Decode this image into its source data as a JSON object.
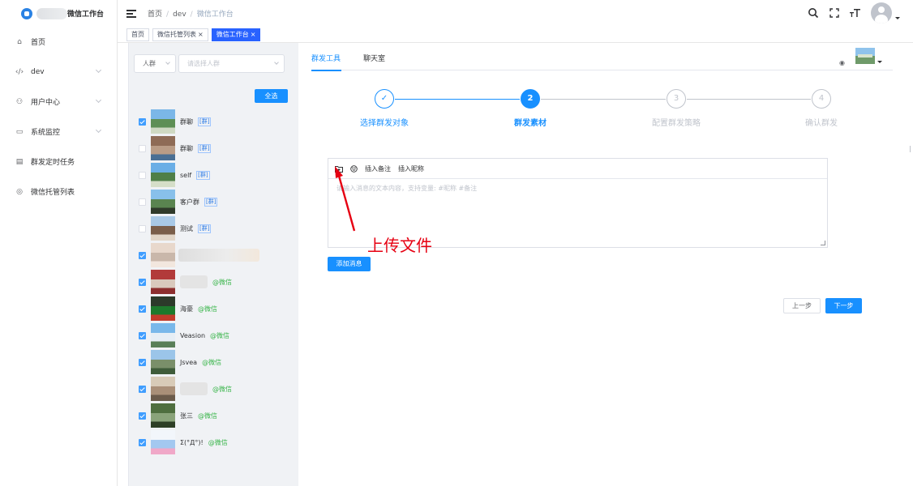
{
  "sidebar": {
    "brand": "微信工作台",
    "items": [
      {
        "label": "首页",
        "icon": "home-icon",
        "glyph": "⌂",
        "has_children": false
      },
      {
        "label": "dev",
        "icon": "code-icon",
        "glyph": "‹/›",
        "has_children": true
      },
      {
        "label": "用户中心",
        "icon": "user-center-icon",
        "glyph": "⚇",
        "has_children": true
      },
      {
        "label": "系统监控",
        "icon": "monitor-icon",
        "glyph": "▭",
        "has_children": true
      },
      {
        "label": "群发定时任务",
        "icon": "task-icon",
        "glyph": "▤",
        "has_children": false
      },
      {
        "label": "微信托管列表",
        "icon": "wechat-list-icon",
        "glyph": "◎",
        "has_children": false
      }
    ]
  },
  "header": {
    "breadcrumb": [
      "首页",
      "dev",
      "微信工作台"
    ]
  },
  "tags": [
    {
      "label": "首页",
      "active": false,
      "closable": false
    },
    {
      "label": "微信托管列表",
      "active": false,
      "closable": true
    },
    {
      "label": "微信工作台",
      "active": true,
      "closable": true
    }
  ],
  "filter": {
    "type_value": "人群",
    "select_placeholder": "请选择人群"
  },
  "select_all_label": "全选",
  "groups": [
    {
      "name": "群聊",
      "tag": "[群]",
      "tag_type": "group",
      "checked": true
    },
    {
      "name": "群聊",
      "tag": "[群]",
      "tag_type": "group",
      "checked": false
    },
    {
      "name": "self",
      "tag": "[群]",
      "tag_type": "group",
      "checked": false
    },
    {
      "name": "客户群",
      "tag": "[群]",
      "tag_type": "group",
      "checked": false
    },
    {
      "name": "测试",
      "tag": "[群]",
      "tag_type": "group",
      "checked": false
    },
    {
      "name": "",
      "tag": "",
      "tag_type": "blurred",
      "checked": true
    },
    {
      "name": "",
      "tag": "@微信",
      "tag_type": "wechat",
      "checked": true
    },
    {
      "name": "海豪",
      "tag": "@微信",
      "tag_type": "wechat",
      "checked": true
    },
    {
      "name": "Veasion",
      "tag": "@微信",
      "tag_type": "wechat",
      "checked": true
    },
    {
      "name": "Jsvea",
      "tag": "@微信",
      "tag_type": "wechat",
      "checked": true
    },
    {
      "name": "",
      "tag": "@微信",
      "tag_type": "wechat",
      "checked": true
    },
    {
      "name": "张三",
      "tag": "@微信",
      "tag_type": "wechat",
      "checked": true
    },
    {
      "name": "Σ(°Д°)!",
      "tag": "@微信",
      "tag_type": "wechat",
      "checked": true
    }
  ],
  "main": {
    "tabs": [
      "群发工具",
      "聊天室"
    ],
    "active_tab": 0,
    "steps": [
      {
        "label": "选择群发对象",
        "number": "✓",
        "status": "done"
      },
      {
        "label": "群发素材",
        "number": "2",
        "status": "current"
      },
      {
        "label": "配置群发策略",
        "number": "3",
        "status": "wait"
      },
      {
        "label": "确认群发",
        "number": "4",
        "status": "wait"
      }
    ],
    "editor": {
      "toolbar": [
        "插入备注",
        "插入昵称"
      ],
      "placeholder": "请输入消息的文本内容，支持变量: #昵称 #备注"
    },
    "add_message_label": "添加消息",
    "prev_label": "上一步",
    "next_label": "下一步"
  },
  "annotation": {
    "text": "上传文件",
    "color": "#e60012"
  },
  "colors": {
    "primary": "#1890ff",
    "tag_active": "#2962ff",
    "wechat_green": "#39b54a",
    "panel_bg": "#f0f2f5"
  }
}
